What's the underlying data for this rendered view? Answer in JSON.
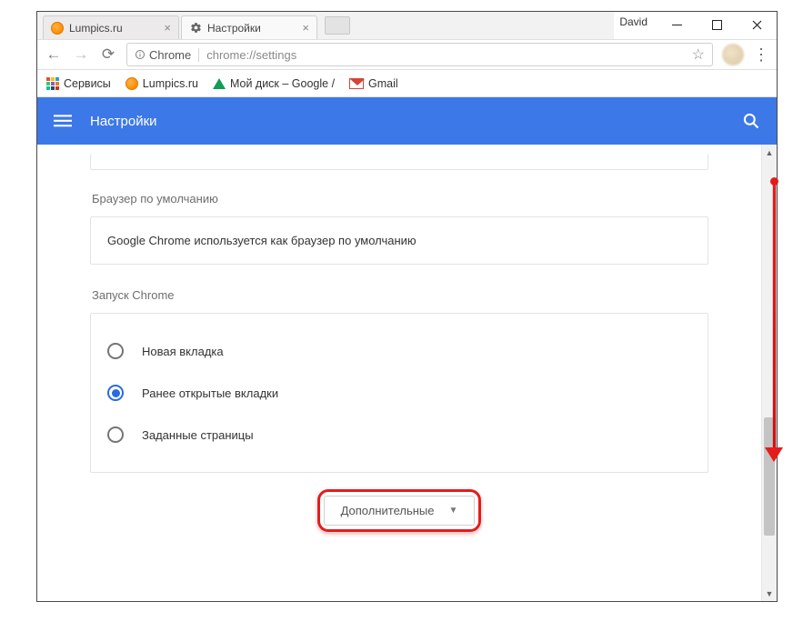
{
  "window": {
    "user": "David"
  },
  "tabs": [
    {
      "label": "Lumpics.ru",
      "active": false
    },
    {
      "label": "Настройки",
      "active": true
    }
  ],
  "omnibox": {
    "chip": "Chrome",
    "url": "chrome://settings"
  },
  "bookmarks": {
    "apps": "Сервисы",
    "items": [
      {
        "label": "Lumpics.ru"
      },
      {
        "label": "Мой диск – Google /"
      },
      {
        "label": "Gmail"
      }
    ]
  },
  "settings": {
    "header_title": "Настройки",
    "default_browser": {
      "section_label": "Браузер по умолчанию",
      "status": "Google Chrome используется как браузер по умолчанию"
    },
    "on_startup": {
      "section_label": "Запуск Chrome",
      "options": [
        {
          "label": "Новая вкладка",
          "checked": false
        },
        {
          "label": "Ранее открытые вкладки",
          "checked": true
        },
        {
          "label": "Заданные страницы",
          "checked": false
        }
      ]
    },
    "advanced_label": "Дополнительные"
  }
}
